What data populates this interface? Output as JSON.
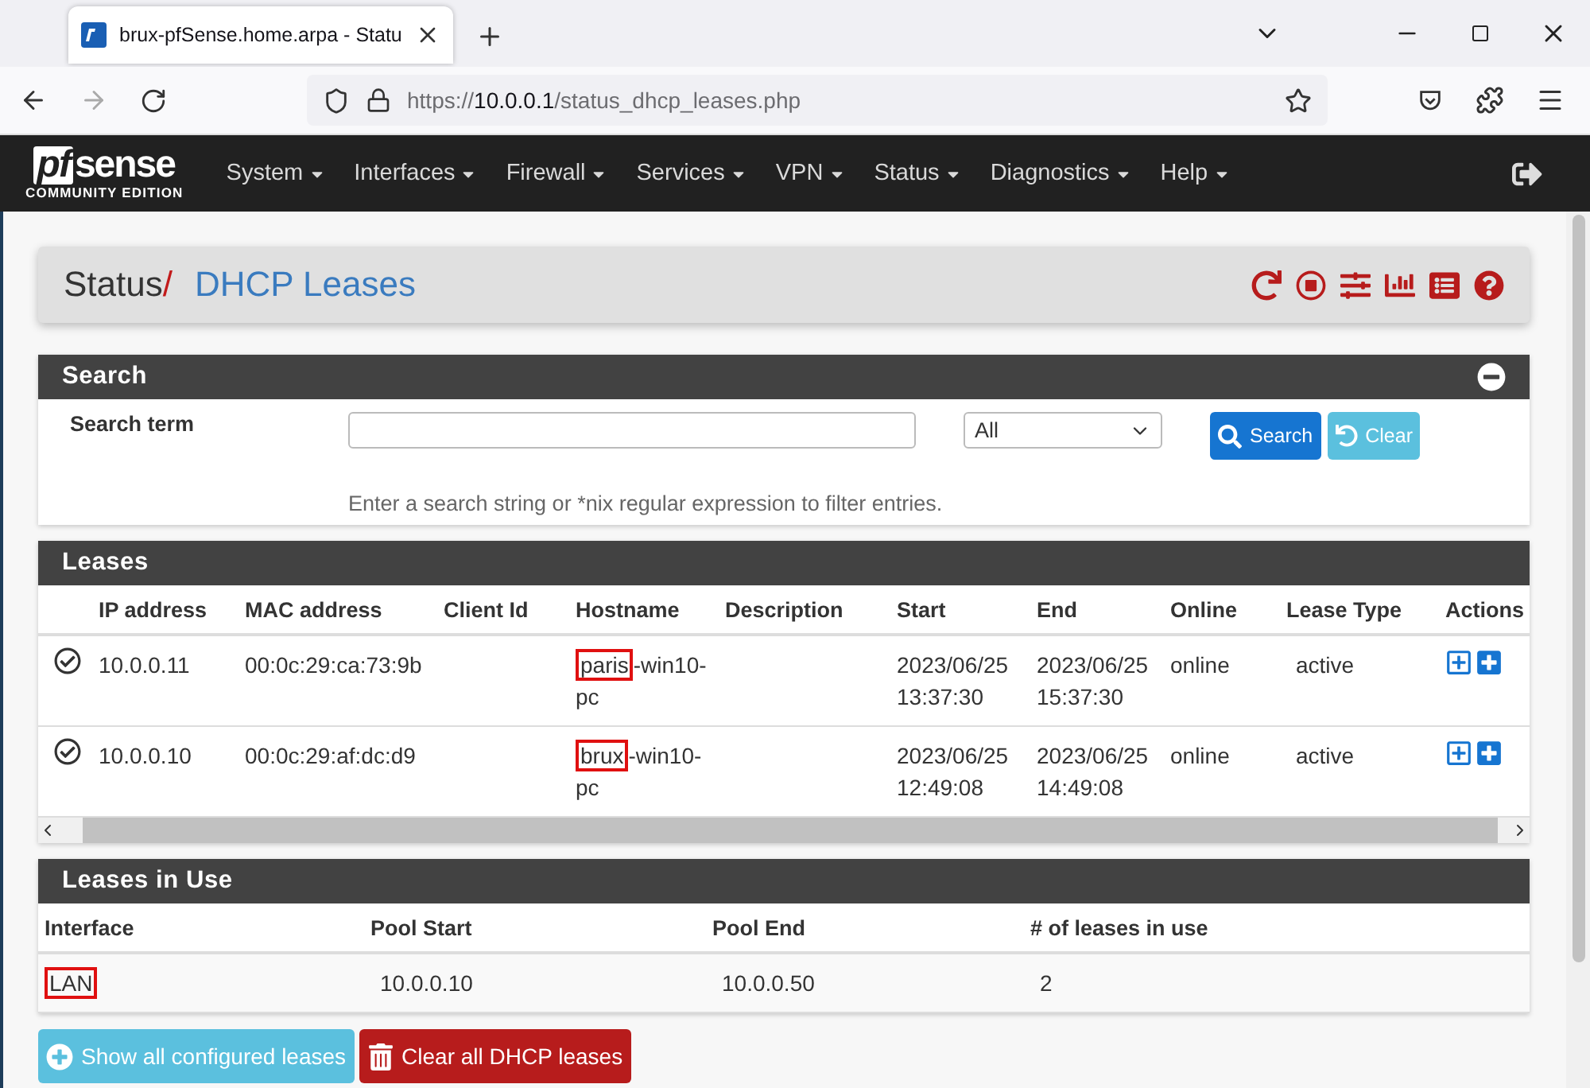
{
  "browser": {
    "tab_title": "brux-pfSense.home.arpa - Statu",
    "url_scheme": "https://",
    "url_host": "10.0.0.1",
    "url_path": "/status_dhcp_leases.php"
  },
  "logo": {
    "brand_prefix": "pf",
    "brand": "sense",
    "edition": "COMMUNITY EDITION"
  },
  "nav": [
    "System",
    "Interfaces",
    "Firewall",
    "Services",
    "VPN",
    "Status",
    "Diagnostics",
    "Help"
  ],
  "breadcrumb": {
    "section": "Status",
    "separator": "/",
    "page": "DHCP Leases"
  },
  "search_panel": {
    "title": "Search",
    "label": "Search term",
    "filter": "All",
    "search_button": "Search",
    "clear_button": "Clear",
    "help": "Enter a search string or *nix regular expression to filter entries."
  },
  "leases_panel": {
    "title": "Leases",
    "columns": [
      "IP address",
      "MAC address",
      "Client Id",
      "Hostname",
      "Description",
      "Start",
      "End",
      "Online",
      "Lease Type",
      "Actions"
    ],
    "rows": [
      {
        "ip": "10.0.0.11",
        "mac": "00:0c:29:ca:73:9b",
        "hostname_marked": "paris",
        "hostname_rest": "-win10-pc",
        "start": "2023/06/25 13:37:30",
        "end": "2023/06/25 15:37:30",
        "online": "online",
        "lease_type": "active"
      },
      {
        "ip": "10.0.0.10",
        "mac": "00:0c:29:af:dc:d9",
        "hostname_marked": "brux",
        "hostname_rest": "-win10-pc",
        "start": "2023/06/25 12:49:08",
        "end": "2023/06/25 14:49:08",
        "online": "online",
        "lease_type": "active"
      }
    ]
  },
  "in_use_panel": {
    "title": "Leases in Use",
    "columns": [
      "Interface",
      "Pool Start",
      "Pool End",
      "# of leases in use"
    ],
    "rows": [
      {
        "interface": "LAN",
        "highlighted": true,
        "pool_start": "10.0.0.10",
        "pool_end": "10.0.0.50",
        "count": "2"
      }
    ]
  },
  "buttons": [
    {
      "label": "Show all configured leases",
      "kind": "info"
    },
    {
      "label": "Clear all DHCP leases",
      "kind": "danger"
    }
  ]
}
